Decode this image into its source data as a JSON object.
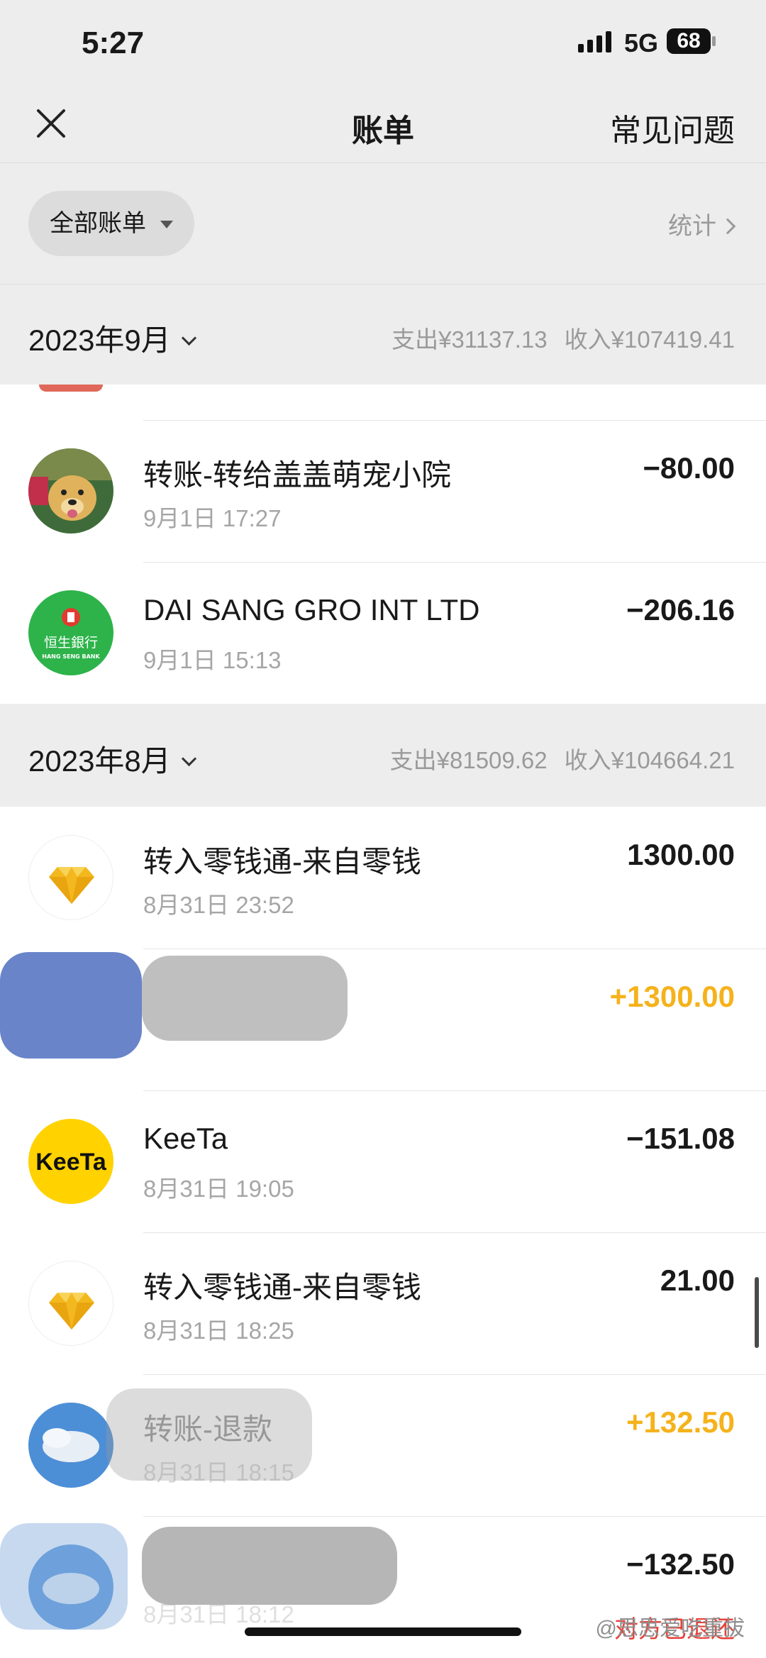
{
  "status_bar": {
    "time": "5:27",
    "network": "5G",
    "battery": "68"
  },
  "nav": {
    "title": "账单",
    "faq": "常见问题"
  },
  "filter": {
    "label": "全部账单",
    "stats": "统计"
  },
  "months": [
    {
      "title": "2023年9月",
      "expense": "支出¥31137.13",
      "income": "收入¥107419.41",
      "transactions": [
        {
          "title": "转账-转给盖盖萌宠小院",
          "time": "9月1日 17:27",
          "amount": "−80.00",
          "avatar": "dog-photo"
        },
        {
          "title": "DAI SANG GRO INT LTD",
          "time": "9月1日 15:13",
          "amount": "−206.16",
          "avatar": "hang-seng-bank-logo",
          "avatar_text": "恒生銀行",
          "avatar_sub": "HANG SENG BANK"
        }
      ]
    },
    {
      "title": "2023年8月",
      "expense": "支出¥81509.62",
      "income": "收入¥104664.21",
      "transactions": [
        {
          "title": "转入零钱通-来自零钱",
          "time": "8月31日 23:52",
          "amount": "1300.00",
          "avatar": "diamond-icon"
        },
        {
          "title": "",
          "time": "",
          "amount": "+1300.00",
          "avatar": "redacted"
        },
        {
          "title": "KeeTa",
          "time": "8月31日 19:05",
          "amount": "−151.08",
          "avatar": "keeta-logo",
          "avatar_text": "KeeTa"
        },
        {
          "title": "转入零钱通-来自零钱",
          "time": "8月31日 18:25",
          "amount": "21.00",
          "avatar": "diamond-icon"
        },
        {
          "title": "转账-退款",
          "time": "8月31日 18:15",
          "amount": "+132.50",
          "avatar": "sky-photo"
        },
        {
          "title": "",
          "time": "8月31日 18:12",
          "amount": "−132.50",
          "avatar": "sky-photo",
          "note": "对方已退还"
        }
      ]
    }
  ],
  "watermark": "@思思爱吃重拔",
  "colors": {
    "background": "#ededed",
    "income": "#f5b21b",
    "refund_note": "#e8413a",
    "hang_seng": "#2db34a",
    "keeta": "#ffd200",
    "diamond": "#f3b81e"
  }
}
